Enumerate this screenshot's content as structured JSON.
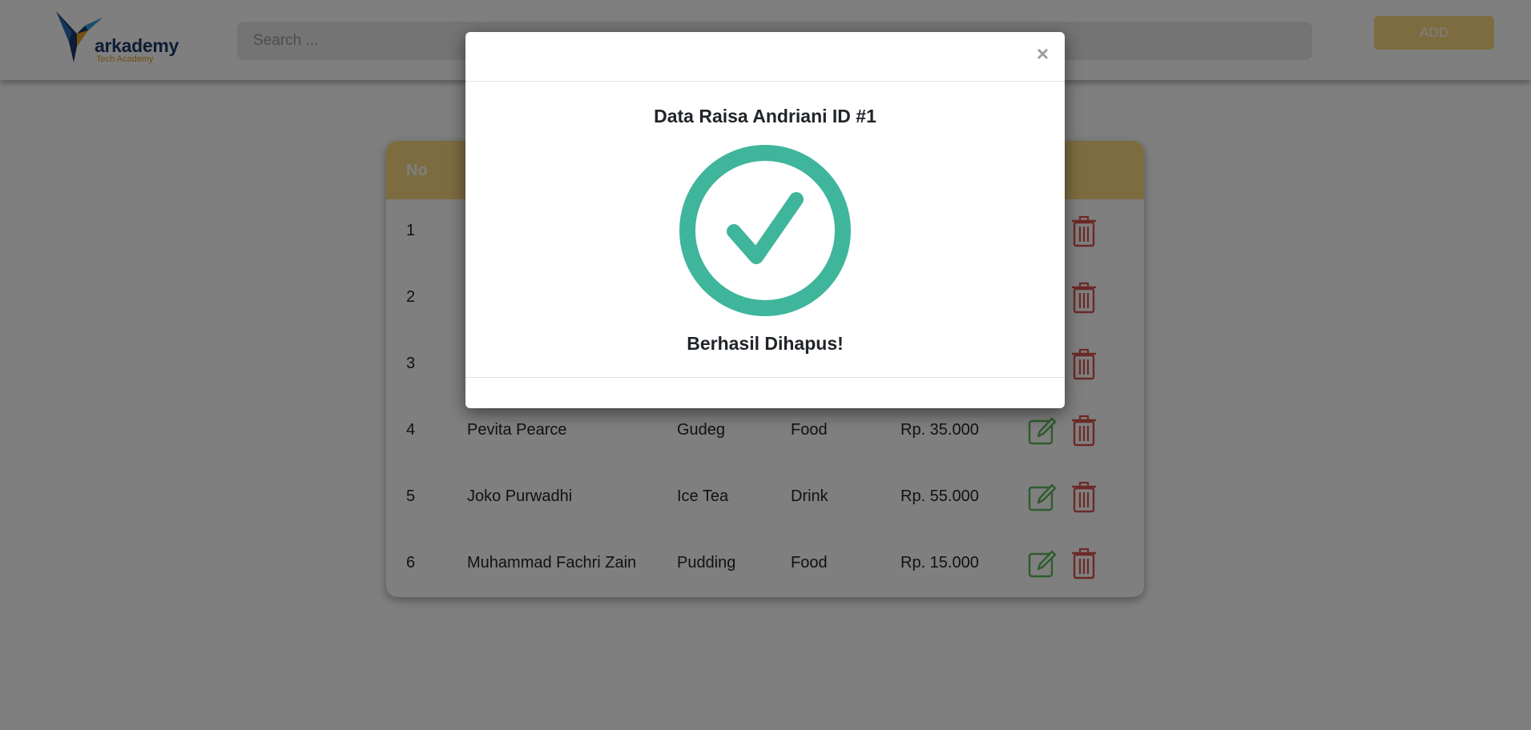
{
  "header": {
    "logo_text": "arkademy",
    "logo_sub": "Tech Academy",
    "search_placeholder": "Search ...",
    "add_label": "ADD"
  },
  "table": {
    "columns": [
      "No"
    ],
    "rows": [
      {
        "no": "1",
        "name": "",
        "product": "",
        "category": "",
        "price": ""
      },
      {
        "no": "2",
        "name": "",
        "product": "",
        "category": "",
        "price": ""
      },
      {
        "no": "3",
        "name": "",
        "product": "",
        "category": "",
        "price": ""
      },
      {
        "no": "4",
        "name": "Pevita Pearce",
        "product": "Gudeg",
        "category": "Food",
        "price": "Rp. 35.000"
      },
      {
        "no": "5",
        "name": "Joko Purwadhi",
        "product": "Ice Tea",
        "category": "Drink",
        "price": "Rp. 55.000"
      },
      {
        "no": "6",
        "name": "Muhammad Fachri Zain",
        "product": "Pudding",
        "category": "Food",
        "price": "Rp. 15.000"
      }
    ]
  },
  "modal": {
    "close_label": "×",
    "title": "Data Raisa Andriani ID #1",
    "message": "Berhasil Dihapus!"
  },
  "colors": {
    "accent": "#fdd882",
    "success": "#3fb59b",
    "edit": "#5cb85c",
    "delete": "#d9534f"
  },
  "icons": {
    "edit": "pencil-square-icon",
    "delete": "trash-icon",
    "success": "check-circle-icon",
    "logo": "hummingbird-logo-icon"
  }
}
